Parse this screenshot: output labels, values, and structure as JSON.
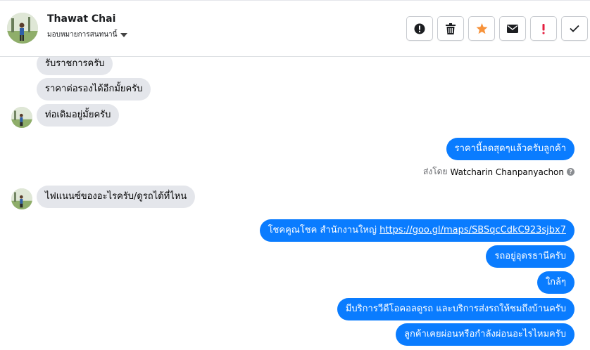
{
  "header": {
    "contact_name": "Thawat Chai",
    "assign_label": "มอบหมายการสนทนานี้",
    "actions": [
      {
        "name": "report-button",
        "icon": "exclamation-circle-icon"
      },
      {
        "name": "delete-button",
        "icon": "trash-icon"
      },
      {
        "name": "star-button",
        "icon": "star-icon",
        "color": "#f7923a"
      },
      {
        "name": "mark-unread-button",
        "icon": "envelope-icon"
      },
      {
        "name": "spam-button",
        "icon": "exclamation-icon",
        "color": "#e41e3f"
      },
      {
        "name": "done-button",
        "icon": "check-icon"
      }
    ]
  },
  "messages": {
    "m1": "รับราชการครับ",
    "m2": "ราคาต่อรองได้อีกมั้ยครับ",
    "m3": "ท่อเดิมอยู่มั้ยครับ",
    "m4": "ราคานี้ลดสุดๆแล้วครับลูกค้า",
    "sent_by_prefix": "ส่งโดย",
    "sent_by_name": "Watcharin Chanpanyachon",
    "m5": "ไฟแนนซ์ของอะไรครับ/ดูรถได้ที่ไหน",
    "m6_text": "โชคคูณโชค สำนักงานใหญ่ ",
    "m6_link": "https://goo.gl/maps/SBSqcCdkC923sjbx7",
    "m7": "รถอยู่อุดรธานีครับ",
    "m8": "ใกล้ๆ",
    "m9": "มีบริการวีดีโอคอลดูรถ และบริการส่งรถให้ชมถึงบ้านครับ",
    "m10": "ลูกค้าเคยผ่อนหรือกำลังผ่อนอะไรไหมครับ"
  },
  "colors": {
    "outgoing_bubble": "#0a7cff",
    "incoming_bubble": "#e4e6eb"
  }
}
